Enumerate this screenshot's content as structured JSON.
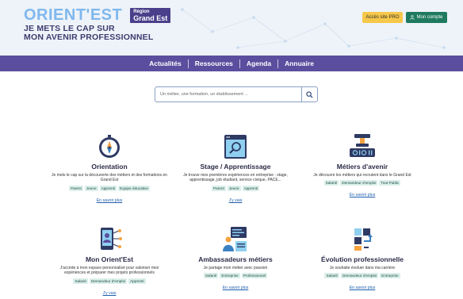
{
  "header": {
    "brand": "ORIENT'EST",
    "region_small": "Région",
    "region": "Grand Est",
    "tagline": [
      "JE METS LE CAP SUR",
      "MON AVENIR PROFESSIONNEL"
    ],
    "pro_button": "Accès site PRO",
    "account_button": "Mon compte"
  },
  "nav": {
    "items": [
      "Actualités",
      "Ressources",
      "Agenda",
      "Annuaire"
    ]
  },
  "search": {
    "placeholder": "Un métier, une formation, un établissement ..."
  },
  "colors": {
    "nav": "#5b4e9e",
    "brand": "#7fb8ee",
    "pro": "#f6c84a",
    "account": "#1f7a5e",
    "tag_bg": "#dcefea",
    "link": "#1f5fae"
  },
  "cards": [
    {
      "icon": "compass-icon",
      "title": "Orientation",
      "desc": "Je mets le cap sur la découverte des métiers et des formations en Grand Est",
      "tags": [
        "Parent",
        "Jeune",
        "Apprenti",
        "Equipe éducative"
      ],
      "link": "En savoir plus"
    },
    {
      "icon": "search-screen-icon",
      "title": "Stage / Apprentissage",
      "desc": "Je trouve mes premières expériences en entreprise : stage, apprentissage, job étudiant, service civique, PACE...",
      "tags": [
        "Parent",
        "Jeune",
        "Apprenti"
      ],
      "link": "J'y vais"
    },
    {
      "icon": "robot-arm-icon",
      "title": "Métiers d'avenir",
      "desc": "Je découvre les métiers qui recrutent dans le Grand Est",
      "tags": [
        "Salarié",
        "Demandeur d'emploi",
        "Tout Public"
      ],
      "link": "En savoir plus"
    },
    {
      "icon": "profile-network-icon",
      "title": "Mon Orient'Est",
      "desc": "J'accède à mon espace personnalisé pour valoriser mes expériences et préparer mes projets professionnels",
      "tags": [
        "Salarié",
        "Demandeur d'emploi",
        "Apprenti"
      ],
      "link": "J'y vais"
    },
    {
      "icon": "ambassador-board-icon",
      "title": "Ambassadeurs métiers",
      "desc": "Je partage mon métier avec passion",
      "tags": [
        "Salarié",
        "Entreprise",
        "Professionnel"
      ],
      "link": "En savoir plus"
    },
    {
      "icon": "career-steps-icon",
      "title": "Évolution professionnelle",
      "desc": "Je souhaite évoluer dans ma carrière",
      "tags": [
        "Salarié",
        "Demandeur d'emploi",
        "Entreprise"
      ],
      "link": "En savoir plus"
    }
  ]
}
